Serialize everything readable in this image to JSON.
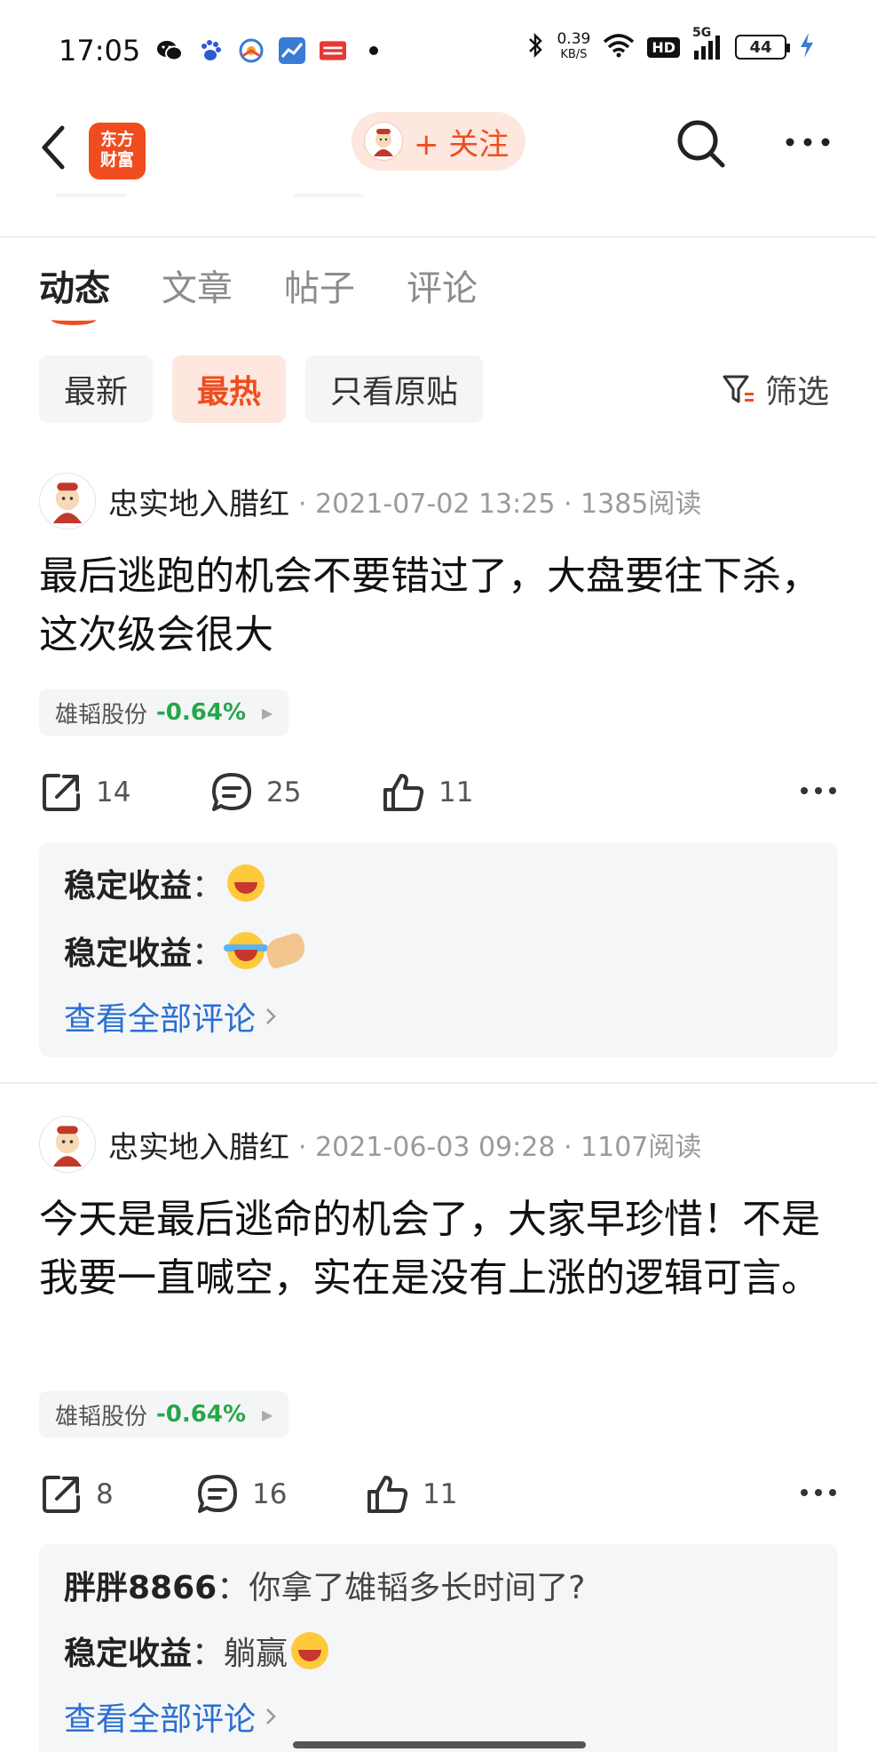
{
  "status_bar": {
    "time": "17:05",
    "net_speed_value": "0.39",
    "net_speed_unit": "KB/S",
    "hd": "HD",
    "network": "5G",
    "battery": "44",
    "icons": [
      "wechat-icon",
      "baidu-icon",
      "browser-icon",
      "stock-app-icon",
      "toutiao-icon",
      "dot-icon",
      "bluetooth-icon",
      "wifi-icon",
      "signal-icon",
      "charging-icon"
    ]
  },
  "nav": {
    "app_logo_line1": "东方",
    "app_logo_line2": "财富",
    "follow_label": "+ 关注"
  },
  "tabs": [
    {
      "label": "动态",
      "active": true
    },
    {
      "label": "文章",
      "active": false
    },
    {
      "label": "帖子",
      "active": false
    },
    {
      "label": "评论",
      "active": false
    }
  ],
  "chips": [
    {
      "label": "最新",
      "active": false
    },
    {
      "label": "最热",
      "active": true
    },
    {
      "label": "只看原贴",
      "active": false
    }
  ],
  "filter_label": "筛选",
  "posts": [
    {
      "author": "忠实地入腊红",
      "meta": "· 2021-07-02 13:25 · 1385阅读",
      "body": "最后逃跑的机会不要错过了，大盘要往下杀，这次级会很大",
      "stock": {
        "name": "雄韬股份",
        "change": "-0.64%"
      },
      "shares": "14",
      "comments_count": "25",
      "likes": "11",
      "comments": [
        {
          "user": "稳定收益",
          "sep": "：",
          "text": ""
        },
        {
          "user": "稳定收益",
          "sep": "：",
          "text": ""
        }
      ],
      "view_all": "查看全部评论"
    },
    {
      "author": "忠实地入腊红",
      "meta": "· 2021-06-03 09:28 · 1107阅读",
      "body": "今天是最后逃命的机会了，大家早珍惜！不是我要一直喊空，实在是没有上涨的逻辑可言。",
      "stock": {
        "name": "雄韬股份",
        "change": "-0.64%"
      },
      "shares": "8",
      "comments_count": "16",
      "likes": "11",
      "comments": [
        {
          "user": "胖胖8866",
          "sep": "：",
          "text": "你拿了雄韬多长时间了?"
        },
        {
          "user": "稳定收益",
          "sep": "：",
          "text": "躺赢"
        }
      ],
      "view_all": "查看全部评论"
    }
  ],
  "colors": {
    "accent": "#ef4d1f",
    "stock_down": "#26a64a",
    "link": "#2a6fd0"
  }
}
